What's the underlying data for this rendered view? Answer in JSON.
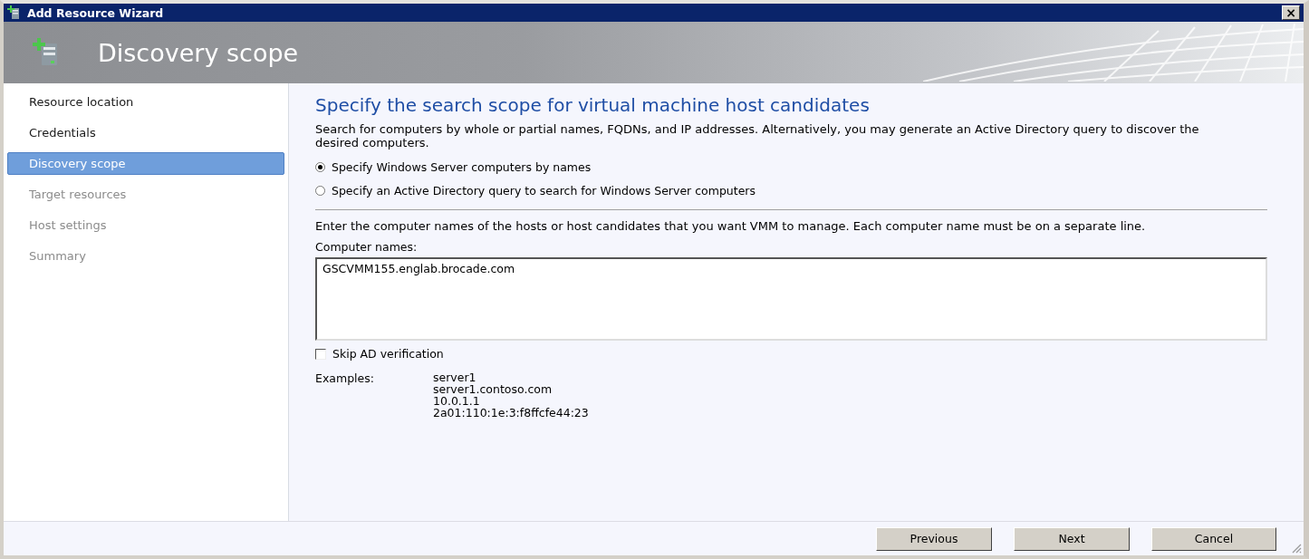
{
  "window": {
    "title": "Add Resource Wizard",
    "close": "×"
  },
  "banner": {
    "title": "Discovery scope"
  },
  "steps": [
    {
      "label": "Resource location",
      "selected": false,
      "disabled": false
    },
    {
      "label": "Credentials",
      "selected": false,
      "disabled": false
    },
    {
      "label": "Discovery scope",
      "selected": true,
      "disabled": false
    },
    {
      "label": "Target resources",
      "selected": false,
      "disabled": true
    },
    {
      "label": "Host settings",
      "selected": false,
      "disabled": true
    },
    {
      "label": "Summary",
      "selected": false,
      "disabled": true
    }
  ],
  "page": {
    "heading": "Specify the search scope for virtual machine host candidates",
    "description": "Search for computers by whole or partial names, FQDNs, and IP addresses. Alternatively, you may generate an Active Directory query to discover the desired computers.",
    "options": [
      {
        "label": "Specify Windows Server computers by names",
        "selected": true
      },
      {
        "label": "Specify an Active Directory query to search for Windows Server computers",
        "selected": false
      }
    ],
    "instructions": "Enter the computer names of the hosts or host candidates that you want VMM to manage. Each computer name must be on a separate line.",
    "names_label": "Computer names:",
    "names_value": "GSCVMM155.englab.brocade.com",
    "skip_verification": {
      "label": "Skip AD verification",
      "checked": false
    },
    "examples_label": "Examples:",
    "examples": [
      "server1",
      "server1.contoso.com",
      "10.0.1.1",
      "2a01:110:1e:3:f8ffcfe44:23"
    ]
  },
  "buttons": [
    {
      "label": "Previous"
    },
    {
      "label": "Next"
    },
    {
      "label": "Cancel"
    }
  ]
}
